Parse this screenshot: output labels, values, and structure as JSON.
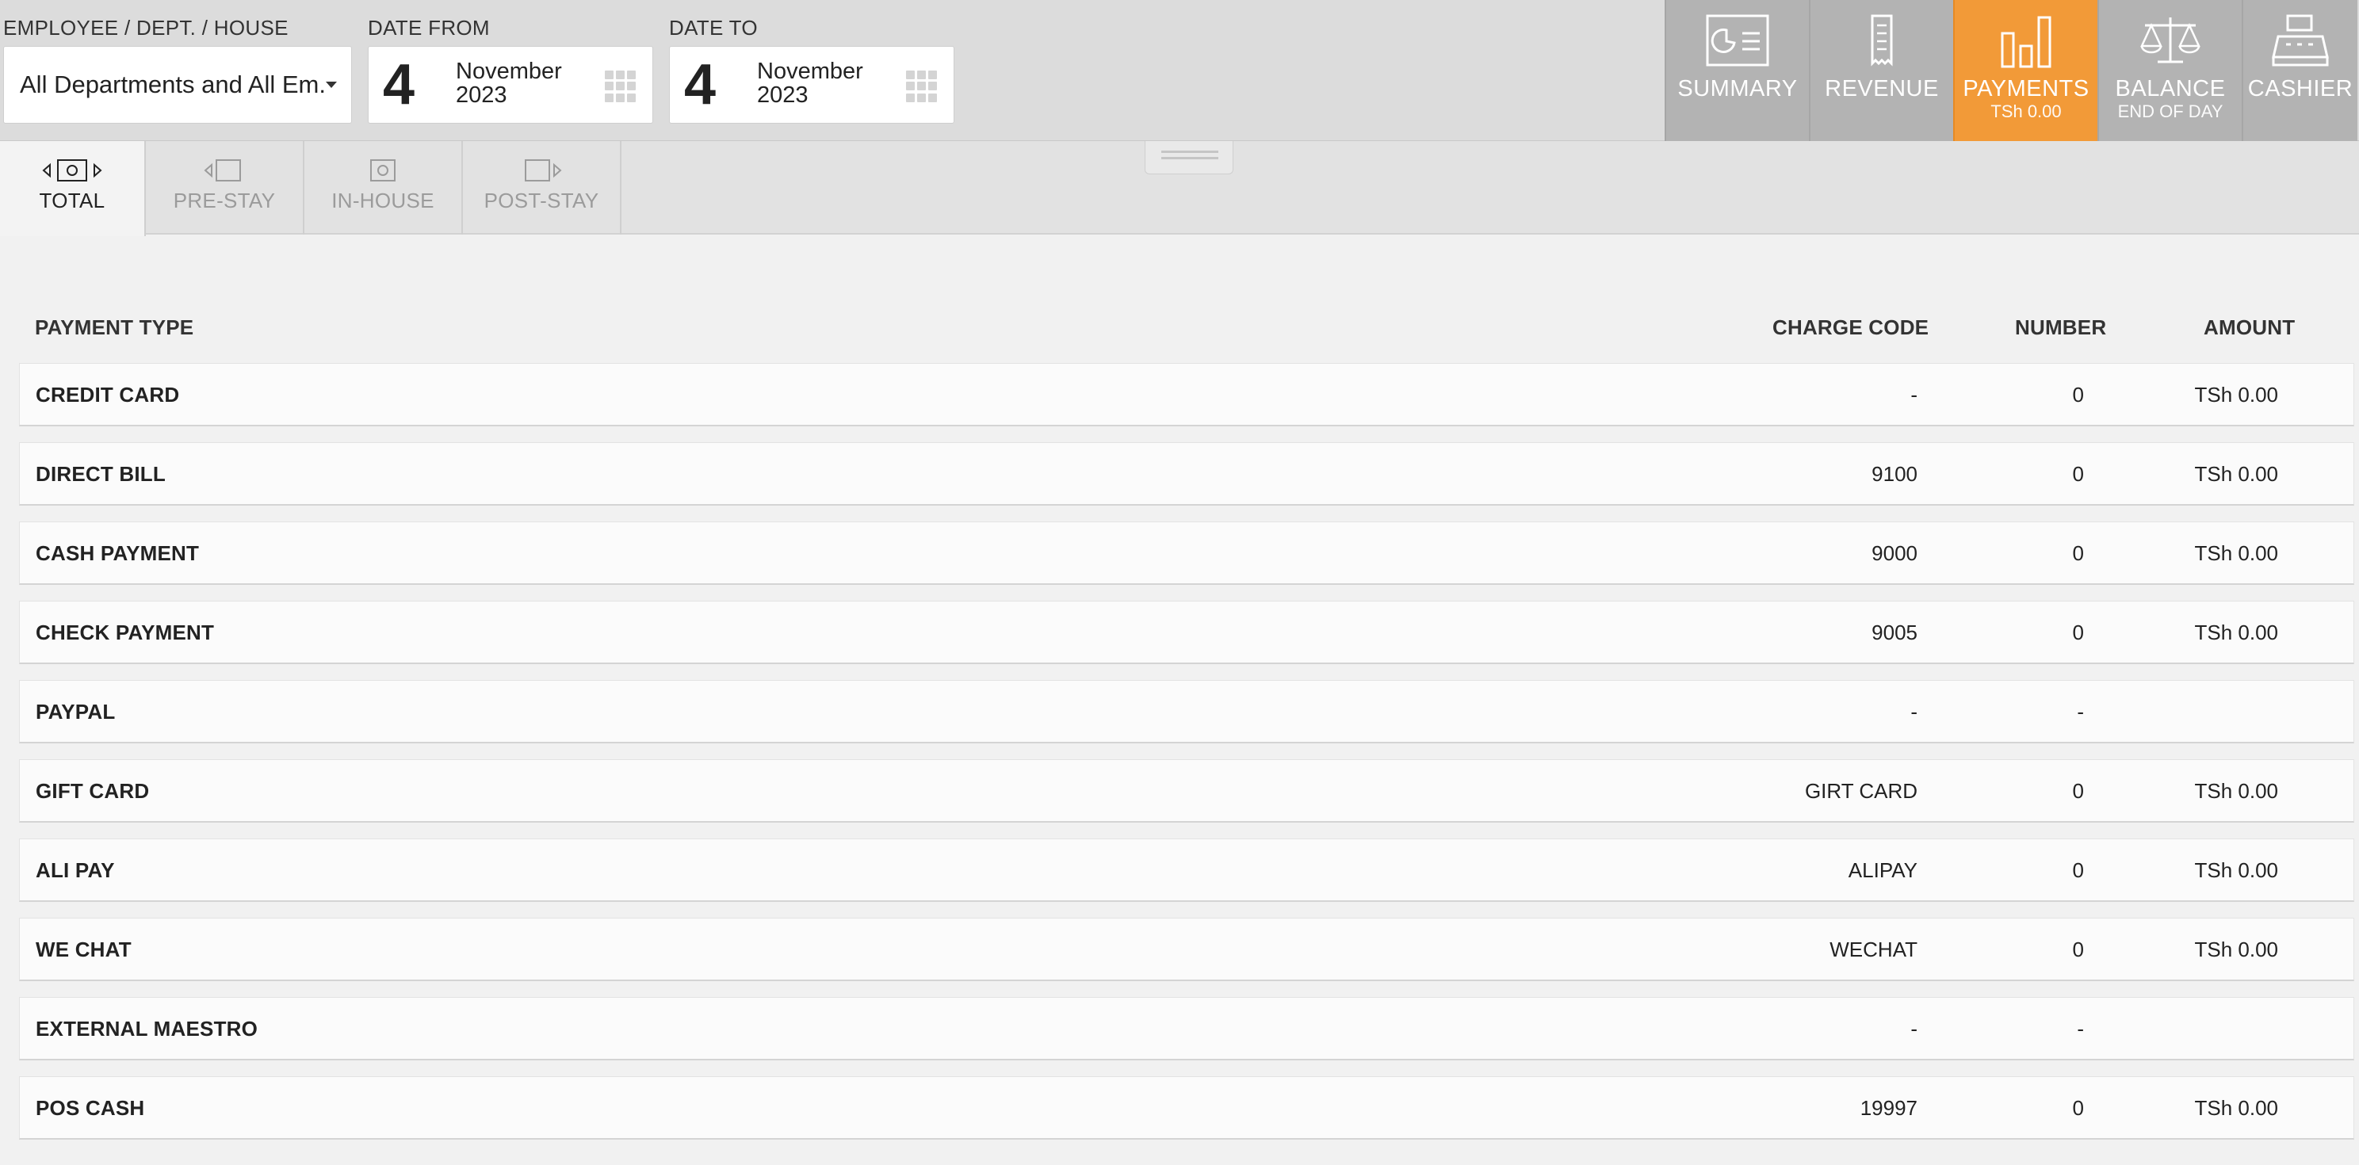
{
  "filters": {
    "employee_label": "EMPLOYEE / DEPT. / HOUSE",
    "employee_value": "All Departments and All Em.",
    "date_from_label": "DATE FROM",
    "date_from": {
      "day": "4",
      "month": "November",
      "year": "2023"
    },
    "date_to_label": "DATE TO",
    "date_to": {
      "day": "4",
      "month": "November",
      "year": "2023"
    }
  },
  "nav": {
    "tiles": [
      {
        "label": "SUMMARY",
        "sub": "",
        "icon": "summary-card-icon"
      },
      {
        "label": "REVENUE",
        "sub": "",
        "icon": "receipt-icon"
      },
      {
        "label": "PAYMENTS",
        "sub": "TSh 0.00",
        "icon": "bar-chart-icon",
        "active": true
      },
      {
        "label": "BALANCE",
        "sub": "END OF DAY",
        "icon": "scales-icon"
      },
      {
        "label": "CASHIER",
        "sub": "",
        "icon": "cash-register-icon"
      }
    ],
    "active_color": "#f29a38",
    "tile_color": "#b3b3b3"
  },
  "stay_tabs": [
    {
      "label": "TOTAL",
      "active": true
    },
    {
      "label": "PRE-STAY",
      "active": false
    },
    {
      "label": "IN-HOUSE",
      "active": false
    },
    {
      "label": "POST-STAY",
      "active": false
    }
  ],
  "table": {
    "headers": {
      "payment_type": "PAYMENT TYPE",
      "charge_code": "CHARGE CODE",
      "number": "NUMBER",
      "amount": "AMOUNT"
    },
    "rows": [
      {
        "type": "CREDIT CARD",
        "code": "-",
        "number": "0",
        "amount": "TSh 0.00"
      },
      {
        "type": "DIRECT BILL",
        "code": "9100",
        "number": "0",
        "amount": "TSh 0.00"
      },
      {
        "type": "CASH PAYMENT",
        "code": "9000",
        "number": "0",
        "amount": "TSh 0.00"
      },
      {
        "type": "CHECK PAYMENT",
        "code": "9005",
        "number": "0",
        "amount": "TSh 0.00"
      },
      {
        "type": "PAYPAL",
        "code": "-",
        "number": "-",
        "amount": ""
      },
      {
        "type": "GIFT CARD",
        "code": "GIRT CARD",
        "number": "0",
        "amount": "TSh 0.00"
      },
      {
        "type": "ALI PAY",
        "code": "ALIPAY",
        "number": "0",
        "amount": "TSh 0.00"
      },
      {
        "type": "WE CHAT",
        "code": "WECHAT",
        "number": "0",
        "amount": "TSh 0.00"
      },
      {
        "type": "EXTERNAL MAESTRO",
        "code": "-",
        "number": "-",
        "amount": ""
      },
      {
        "type": "POS CASH",
        "code": "19997",
        "number": "0",
        "amount": "TSh 0.00"
      }
    ]
  }
}
